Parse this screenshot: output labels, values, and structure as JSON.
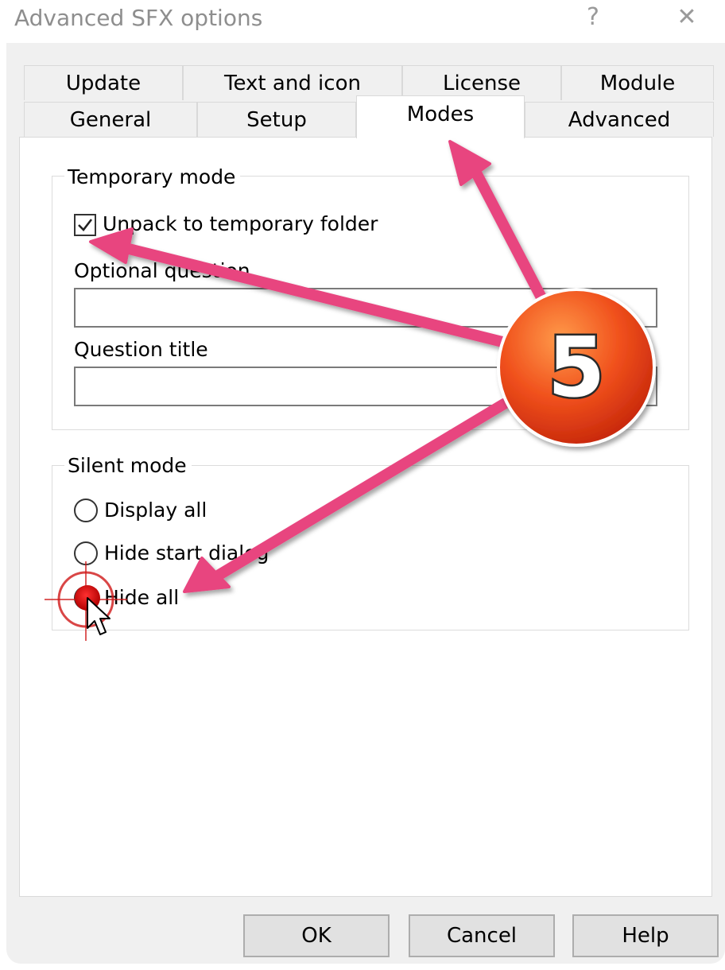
{
  "window": {
    "title": "Advanced SFX options",
    "help_glyph": "?",
    "close_glyph": "✕"
  },
  "tabs": {
    "row1": [
      {
        "label": "Update"
      },
      {
        "label": "Text and icon"
      },
      {
        "label": "License"
      },
      {
        "label": "Module"
      }
    ],
    "row2": [
      {
        "label": "General"
      },
      {
        "label": "Setup"
      },
      {
        "label": "Modes",
        "active": true
      },
      {
        "label": "Advanced"
      }
    ]
  },
  "temporary_mode": {
    "legend": "Temporary mode",
    "unpack_checkbox": {
      "label": "Unpack to temporary folder",
      "checked": true
    },
    "optional_question": {
      "label": "Optional question",
      "value": ""
    },
    "question_title": {
      "label": "Question title",
      "value": ""
    }
  },
  "silent_mode": {
    "legend": "Silent mode",
    "options": [
      {
        "label": "Display all",
        "selected": false
      },
      {
        "label": "Hide start dialog",
        "selected": false
      },
      {
        "label": "Hide all",
        "selected": true
      }
    ]
  },
  "buttons": {
    "ok": "OK",
    "cancel": "Cancel",
    "help": "Help"
  },
  "annotation": {
    "step_number": "5",
    "arrow_color": "#e8457f",
    "badge_color": "#e84a1a"
  }
}
